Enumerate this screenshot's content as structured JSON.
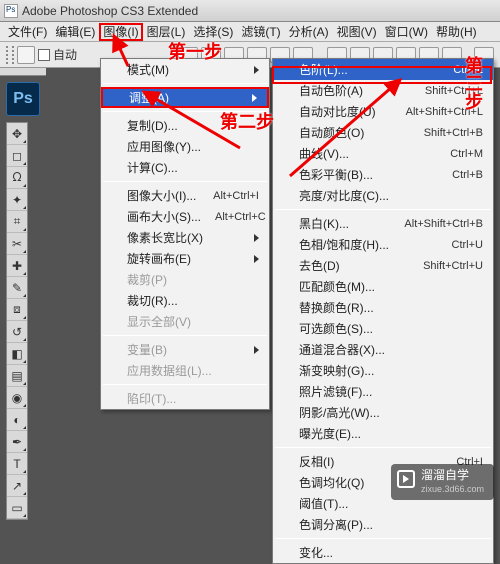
{
  "title": "Adobe Photoshop CS3 Extended",
  "menubar": [
    "文件(F)",
    "编辑(E)",
    "图像(I)",
    "图层(L)",
    "选择(S)",
    "滤镜(T)",
    "分析(A)",
    "视图(V)",
    "窗口(W)",
    "帮助(H)"
  ],
  "menubar_hl_index": 2,
  "optionsbar": {
    "auto_label": "自动"
  },
  "steps": {
    "s1": "第一步",
    "s2": "第二步",
    "s3": "第三步"
  },
  "menu1": [
    {
      "t": "模式(M)",
      "arrow": true
    },
    {
      "sep": true
    },
    {
      "t": "调整(A)",
      "arrow": true,
      "hl": true
    },
    {
      "sep": true
    },
    {
      "t": "复制(D)..."
    },
    {
      "t": "应用图像(Y)..."
    },
    {
      "t": "计算(C)..."
    },
    {
      "sep": true
    },
    {
      "t": "图像大小(I)...",
      "sc": "Alt+Ctrl+I"
    },
    {
      "t": "画布大小(S)...",
      "sc": "Alt+Ctrl+C"
    },
    {
      "t": "像素长宽比(X)",
      "arrow": true
    },
    {
      "t": "旋转画布(E)",
      "arrow": true
    },
    {
      "t": "裁剪(P)",
      "disabled": true
    },
    {
      "t": "裁切(R)..."
    },
    {
      "t": "显示全部(V)",
      "disabled": true
    },
    {
      "sep": true
    },
    {
      "t": "变量(B)",
      "arrow": true,
      "disabled": true
    },
    {
      "t": "应用数据组(L)...",
      "disabled": true
    },
    {
      "sep": true
    },
    {
      "t": "陷印(T)...",
      "disabled": true
    }
  ],
  "menu2": [
    {
      "t": "色阶(L)...",
      "sc": "Ctrl+L",
      "hl": true
    },
    {
      "t": "自动色阶(A)",
      "sc": "Shift+Ctrl+L"
    },
    {
      "t": "自动对比度(U)",
      "sc": "Alt+Shift+Ctrl+L"
    },
    {
      "t": "自动颜色(O)",
      "sc": "Shift+Ctrl+B"
    },
    {
      "t": "曲线(V)...",
      "sc": "Ctrl+M"
    },
    {
      "t": "色彩平衡(B)...",
      "sc": "Ctrl+B"
    },
    {
      "t": "亮度/对比度(C)..."
    },
    {
      "sep": true
    },
    {
      "t": "黑白(K)...",
      "sc": "Alt+Shift+Ctrl+B"
    },
    {
      "t": "色相/饱和度(H)...",
      "sc": "Ctrl+U"
    },
    {
      "t": "去色(D)",
      "sc": "Shift+Ctrl+U"
    },
    {
      "t": "匹配颜色(M)..."
    },
    {
      "t": "替换颜色(R)..."
    },
    {
      "t": "可选颜色(S)..."
    },
    {
      "t": "通道混合器(X)..."
    },
    {
      "t": "渐变映射(G)..."
    },
    {
      "t": "照片滤镜(F)..."
    },
    {
      "t": "阴影/高光(W)..."
    },
    {
      "t": "曝光度(E)..."
    },
    {
      "sep": true
    },
    {
      "t": "反相(I)",
      "sc": "Ctrl+I"
    },
    {
      "t": "色调均化(Q)"
    },
    {
      "t": "阈值(T)..."
    },
    {
      "t": "色调分离(P)..."
    },
    {
      "sep": true
    },
    {
      "t": "变化..."
    }
  ],
  "tools": [
    "move",
    "marquee",
    "lasso",
    "wand",
    "crop",
    "slice",
    "heal",
    "brush",
    "stamp",
    "history",
    "eraser",
    "gradient",
    "blur",
    "dodge",
    "pen",
    "type",
    "path",
    "shape"
  ],
  "watermark": {
    "line1": "溜溜自学",
    "line2": "zixue.3d66.com"
  }
}
